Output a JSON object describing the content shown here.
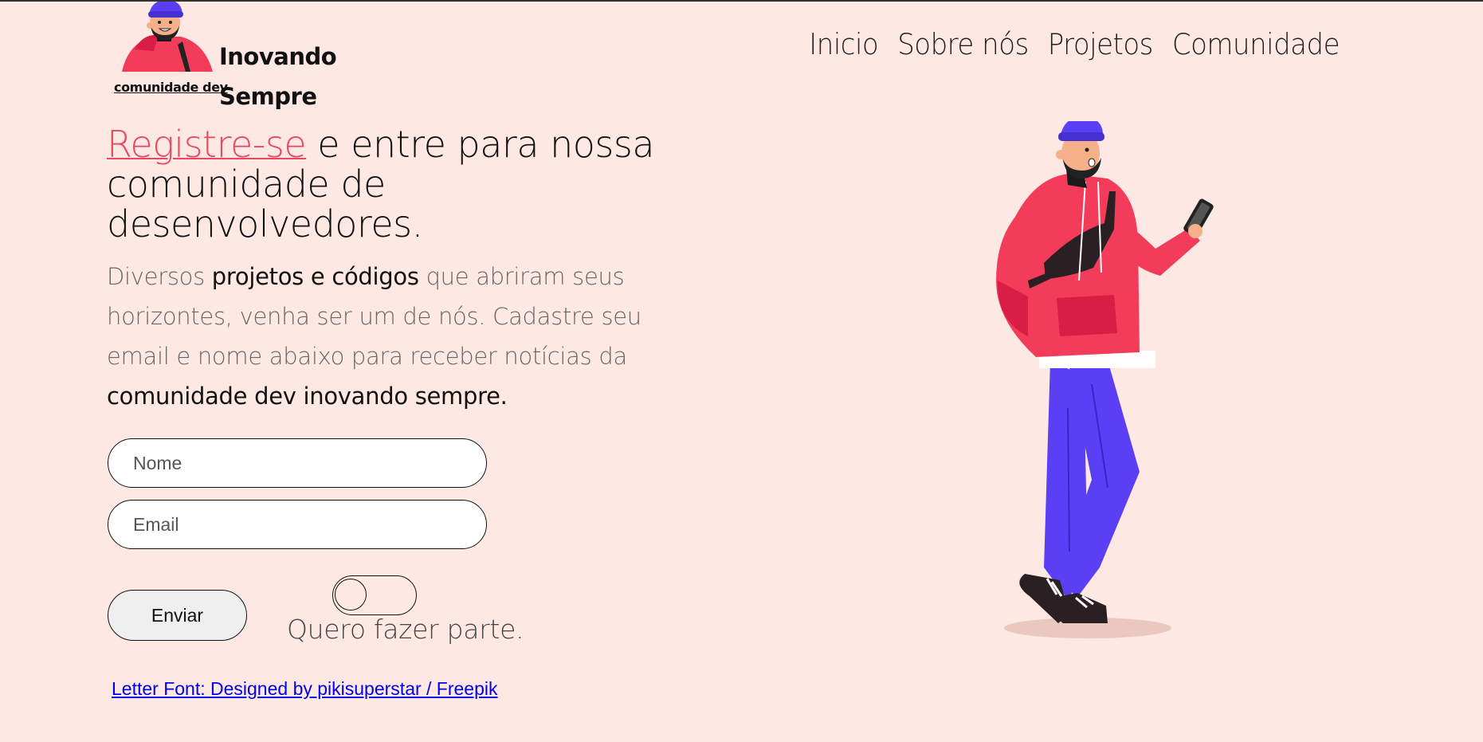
{
  "logo": {
    "title_line1": "Inovando",
    "title_line2": "Sempre",
    "subtitle": "comunidade dev",
    "avatar_icon": "developer-avatar-icon"
  },
  "nav": {
    "items": [
      "Inicio",
      "Sobre nós",
      "Projetos",
      "Comunidade"
    ]
  },
  "hero": {
    "headline_link": "Registre-se",
    "headline_rest": " e entre para nossa comunidade de desenvolvedores.",
    "desc_part1": "Diversos ",
    "desc_strong1": "projetos e códigos",
    "desc_part2": " que abriram seus horizontes, venha ser um de nós. Cadastre seu email e nome abaixo para receber notícias da ",
    "desc_strong2": "comunidade dev inovando sempre."
  },
  "form": {
    "name_placeholder": "Nome",
    "email_placeholder": "Email",
    "submit_label": "Enviar",
    "toggle_label": "Quero fazer parte.",
    "toggle_on": false
  },
  "credit": {
    "text": "Letter Font: Designed by pikisuperstar / Freepik"
  },
  "colors": {
    "background": "#fde8e3",
    "accent": "#e8475f",
    "hoodie": "#f23c5a",
    "pants": "#5b3ff5"
  },
  "illustration": {
    "icon": "developer-character-illustration"
  }
}
